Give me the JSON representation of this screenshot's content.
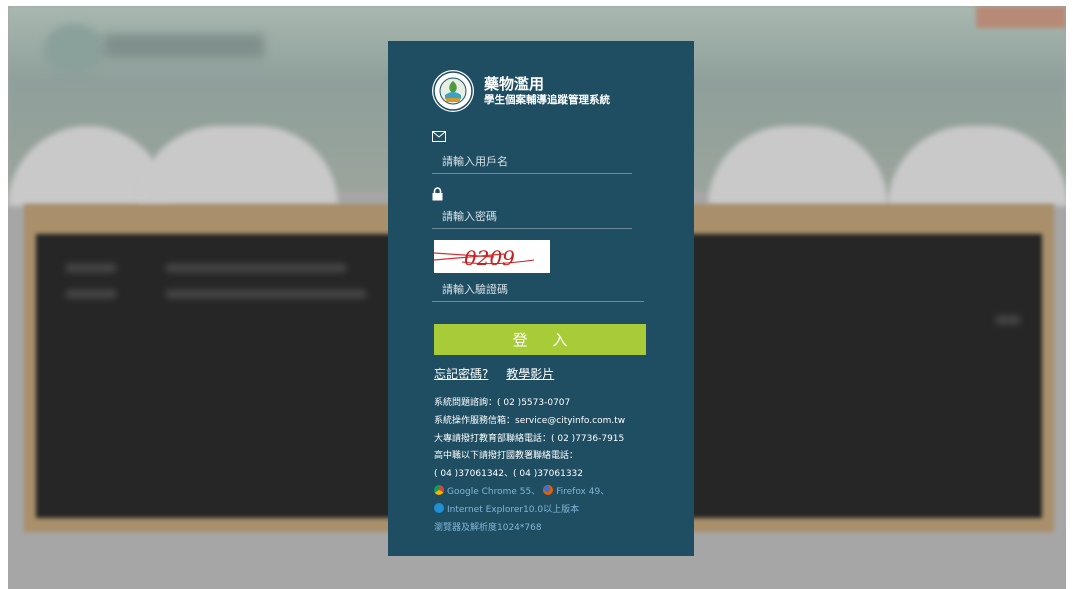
{
  "logo": {
    "emblem_text": "MINISTRY OF EDUCATION",
    "title": "藥物濫用",
    "subtitle": "學生個案輔導追蹤管理系統"
  },
  "login": {
    "username_placeholder": "請輸入用戶名",
    "password_placeholder": "請輸入密碼",
    "captcha_text": "0209",
    "captcha_placeholder": "請輸入驗證碼",
    "submit_label": "登 入",
    "forgot_password_label": "忘記密碼?",
    "tutorial_label": "教學影片"
  },
  "info": {
    "line1": "系統問題諮詢：( 02 )5573-0707",
    "line2": "系統操作服務信箱：service@cityinfo.com.tw",
    "line3": "大專請撥打教育部聯絡電話：( 02 )7736-7915",
    "line4": "高中職以下請撥打國教署聯絡電話：",
    "line5": "( 04 )37061342、( 04 )37061332",
    "browser1": "Google Chrome 55、",
    "browser2": "Firefox 49、",
    "browser3": "Internet Explorer10.0以上版本",
    "line_resolution": "瀏覽器及解析度1024*768"
  },
  "colors": {
    "panel": "#1f4e63",
    "button": "#a7cc38",
    "link_highlight": "#7fb6d6"
  },
  "icons": {
    "username": "envelope-icon",
    "password": "lock-icon",
    "chrome": "chrome-icon",
    "firefox": "firefox-icon",
    "ie": "ie-icon"
  }
}
